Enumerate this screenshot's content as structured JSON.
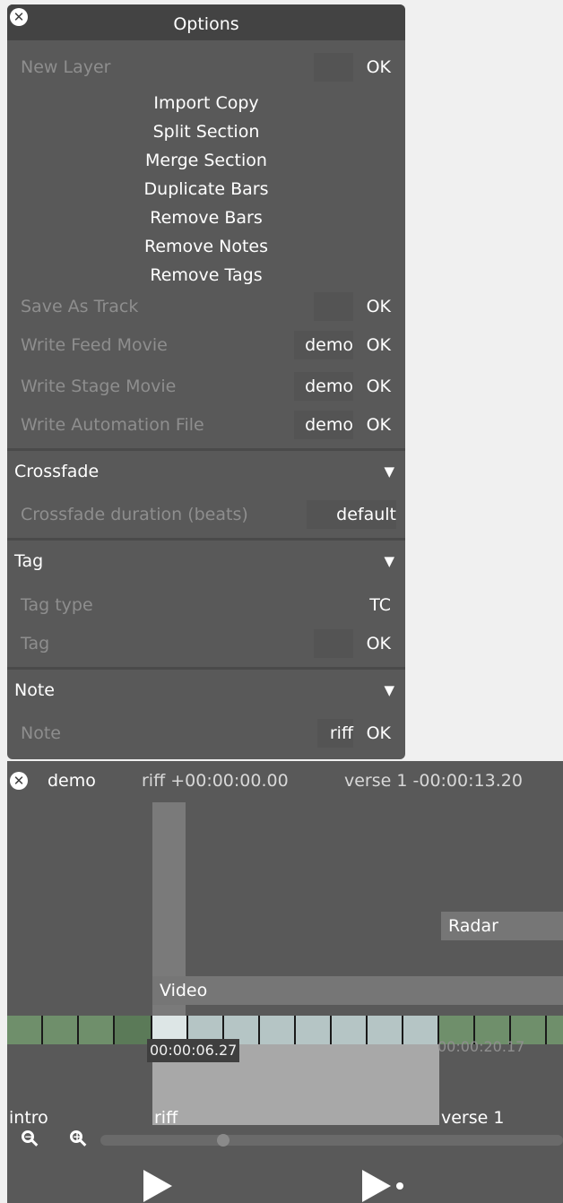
{
  "options": {
    "title": "Options",
    "close_icon": "✕",
    "rows": {
      "new_layer": {
        "label": "New Layer",
        "input": "",
        "ok": "OK"
      },
      "save_as_track": {
        "label": "Save As Track",
        "input": "",
        "ok": "OK"
      },
      "write_feed_movie": {
        "label": "Write Feed Movie",
        "input": "demo",
        "ok": "OK"
      },
      "write_stage_movie": {
        "label": "Write Stage Movie",
        "input": "demo",
        "ok": "OK"
      },
      "write_automation_file": {
        "label": "Write Automation File",
        "input": "demo",
        "ok": "OK"
      }
    },
    "actions": [
      "Import Copy",
      "Split Section",
      "Merge Section",
      "Duplicate Bars",
      "Remove Bars",
      "Remove Notes",
      "Remove Tags"
    ],
    "crossfade": {
      "header": "Crossfade",
      "toggle_icon": "▼",
      "duration_label": "Crossfade duration (beats)",
      "duration_value": "default"
    },
    "tag": {
      "header": "Tag",
      "toggle_icon": "▼",
      "type_label": "Tag type",
      "type_value": "TC",
      "tag_label": "Tag",
      "tag_input": "",
      "ok": "OK"
    },
    "note": {
      "header": "Note",
      "toggle_icon": "▼",
      "note_label": "Note",
      "note_input": "riff",
      "ok": "OK"
    }
  },
  "timeline": {
    "close_icon": "✕",
    "name": "demo",
    "current_position": "riff +00:00:00.00",
    "next_position": "verse 1 -00:00:13.20",
    "layers": {
      "radar": "Radar",
      "video": "Video"
    },
    "selection_start": "00:00:06.27",
    "selection_end": "00:00:20.17",
    "sections": [
      "intro",
      "riff",
      "verse 1"
    ],
    "zoom_out_icon": "zoom-out-icon",
    "zoom_in_icon": "zoom-in-icon",
    "scroll_position": 0.26,
    "colors": {
      "strip_green": "#6f8f6b",
      "strip_green_dark": "#5b7a58",
      "strip_selected": "#b5c5c5",
      "strip_playhead": "#dde6e6"
    }
  }
}
